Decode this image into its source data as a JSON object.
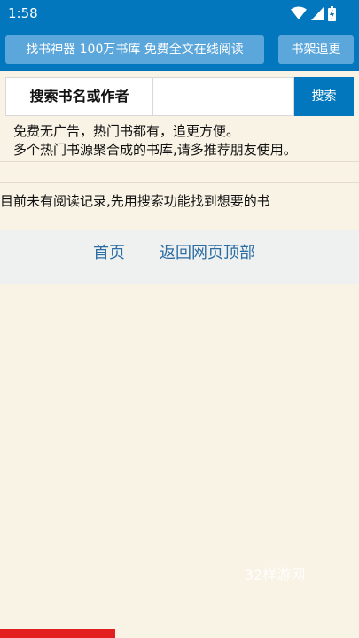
{
  "status_bar": {
    "time": "1:58",
    "icons": [
      "wifi-icon",
      "signal-icon",
      "battery-icon"
    ]
  },
  "header": {
    "title": "找书神器 100万书库 免费全文在线阅读",
    "shelf_button": "书架追更"
  },
  "search": {
    "label": "搜索书名或作者",
    "value": "",
    "button": "搜索"
  },
  "notice": {
    "line1": "免费无广告，热门书都有，追更方便。",
    "line2": "多个热门书源聚合成的书库,请多推荐朋友使用。"
  },
  "history": {
    "empty_message": "目前未有阅读记录,先用搜索功能找到想要的书"
  },
  "footer": {
    "home": "首页",
    "back_to_top": "返回网页顶部"
  },
  "watermark": "32样游网",
  "colors": {
    "primary": "#0277bd",
    "button_light": "#5ba7dc",
    "background": "#f9f3e6",
    "link": "#2b6ca3",
    "accent_red": "#e31f1f"
  }
}
